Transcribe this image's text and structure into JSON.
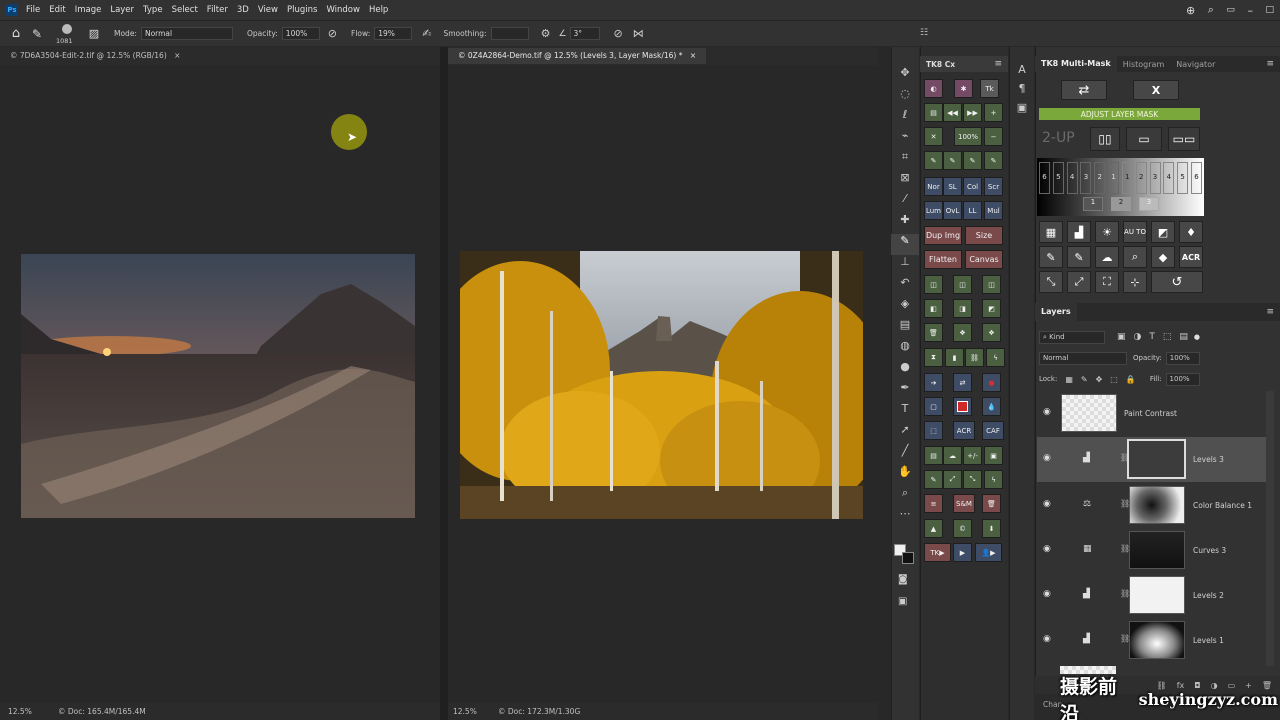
{
  "menu": {
    "logo": "Ps",
    "items": [
      "File",
      "Edit",
      "Image",
      "Layer",
      "Type",
      "Select",
      "Filter",
      "3D",
      "View",
      "Plugins",
      "Window",
      "Help"
    ]
  },
  "options": {
    "brush_size": "1081",
    "mode_label": "Mode:",
    "mode_value": "Normal",
    "opacity_label": "Opacity:",
    "opacity_value": "100%",
    "flow_label": "Flow:",
    "flow_value": "19%",
    "smoothing_label": "Smoothing:",
    "angle_value": "3°"
  },
  "docs": [
    {
      "tab": "© 7D6A3504-Edit-2.tif @ 12.5% (RGB/16)",
      "zoom": "12.5%",
      "info": "© Doc: 165.4M/165.4M"
    },
    {
      "tab": "© 0Z4A2864-Demo.tif @ 12.5% (Levels 3, Layer Mask/16) *",
      "zoom": "12.5%",
      "info": "© Doc: 172.3M/1.30G"
    }
  ],
  "tk8": {
    "title": "TK8 Cx",
    "labels": {
      "pct": "100%",
      "nor": "Nor",
      "sl": "SL",
      "col": "Col",
      "scr": "Scr",
      "lum": "Lum",
      "ovl": "OvL",
      "ll": "LL",
      "mul": "Mul",
      "dup": "Dup Img",
      "size": "Size",
      "flatten": "Flatten",
      "canvas": "Canvas",
      "acr": "ACR",
      "caf": "CAF",
      "sm": "S&M",
      "tk": "TK",
      "pm": "+/-"
    }
  },
  "multimask": {
    "tabs": [
      "TK8 Multi-Mask",
      "Histogram",
      "Navigator"
    ],
    "swap": "⇄",
    "close": "X",
    "adjust": "ADJUST LAYER MASK",
    "twoup": "2-UP",
    "zone_numbers": [
      "6",
      "5",
      "4",
      "3",
      "2",
      "1",
      "1",
      "2",
      "3",
      "4",
      "5",
      "6"
    ],
    "sub_numbers": [
      "1",
      "2",
      "3"
    ],
    "auto": "AU TO",
    "acr": "ACR"
  },
  "layers": {
    "title": "Layers",
    "filter": "Kind",
    "blend": "Normal",
    "opacity_label": "Opacity:",
    "opacity_value": "100%",
    "lock_label": "Lock:",
    "fill_label": "Fill:",
    "fill_value": "100%",
    "items": [
      {
        "name": "Paint Contrast"
      },
      {
        "name": "Levels 3"
      },
      {
        "name": "Color Balance 1"
      },
      {
        "name": "Curves 3"
      },
      {
        "name": "Levels 2"
      },
      {
        "name": "Levels 1"
      }
    ],
    "bottom_label": "Chan"
  },
  "watermark": {
    "cn": "摄影前沿",
    "url": "sheyingzyz.com"
  }
}
